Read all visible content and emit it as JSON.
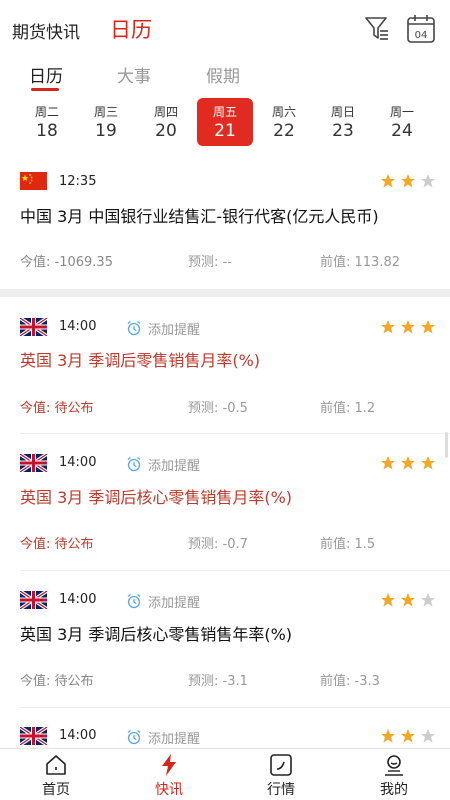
{
  "header": {
    "app_title": "期货快讯",
    "page_title": "日历",
    "calendar_icon_text": "04"
  },
  "tabs": [
    {
      "label": "日历",
      "active": true
    },
    {
      "label": "大事",
      "active": false
    },
    {
      "label": "假期",
      "active": false
    }
  ],
  "days": [
    {
      "weekday": "周二",
      "date": "18",
      "active": false
    },
    {
      "weekday": "周三",
      "date": "19",
      "active": false
    },
    {
      "weekday": "周四",
      "date": "20",
      "active": false
    },
    {
      "weekday": "周五",
      "date": "21",
      "active": true
    },
    {
      "weekday": "周六",
      "date": "22",
      "active": false
    },
    {
      "weekday": "周日",
      "date": "23",
      "active": false
    },
    {
      "weekday": "周一",
      "date": "24",
      "active": false
    }
  ],
  "events": [
    {
      "country_flag": "china-flag",
      "time": "12:35",
      "remind_label": "",
      "stars": 2,
      "title": "中国  3月  中国银行业结售汇-银行代客(亿元人民币)",
      "actual": "今值: -1069.35",
      "forecast": "预测: --",
      "previous": "前值: 113.82"
    },
    {
      "country_flag": "uk-flag",
      "time": "14:00",
      "remind_label": "添加提醒",
      "stars": 3,
      "title": "英国  3月  季调后零售销售月率(%)",
      "actual": "今值: 待公布",
      "forecast": "预测: -0.5",
      "previous": "前值: 1.2"
    },
    {
      "country_flag": "uk-flag",
      "time": "14:00",
      "remind_label": "添加提醒",
      "stars": 3,
      "title": "英国  3月  季调后核心零售销售月率(%)",
      "actual": "今值: 待公布",
      "forecast": "预测: -0.7",
      "previous": "前值: 1.5"
    },
    {
      "country_flag": "uk-flag",
      "time": "14:00",
      "remind_label": "添加提醒",
      "stars": 2,
      "title": "英国  3月  季调后核心零售销售年率(%)",
      "actual": "今值: 待公布",
      "forecast": "预测: -3.1",
      "previous": "前值: -3.3"
    },
    {
      "country_flag": "uk-flag",
      "time": "14:00",
      "remind_label": "添加提醒",
      "stars": 2
    }
  ],
  "bottom_nav": [
    {
      "label": "首页",
      "icon": "home-icon",
      "active": false
    },
    {
      "label": "快讯",
      "icon": "lightning-icon",
      "active": true
    },
    {
      "label": "行情",
      "icon": "chart-icon",
      "active": false
    },
    {
      "label": "我的",
      "icon": "profile-icon",
      "active": false
    }
  ],
  "colors": {
    "accent": "#d9261c",
    "star_on": "#f5a623",
    "star_off": "#cccccc",
    "important_title": "#c0392b"
  }
}
